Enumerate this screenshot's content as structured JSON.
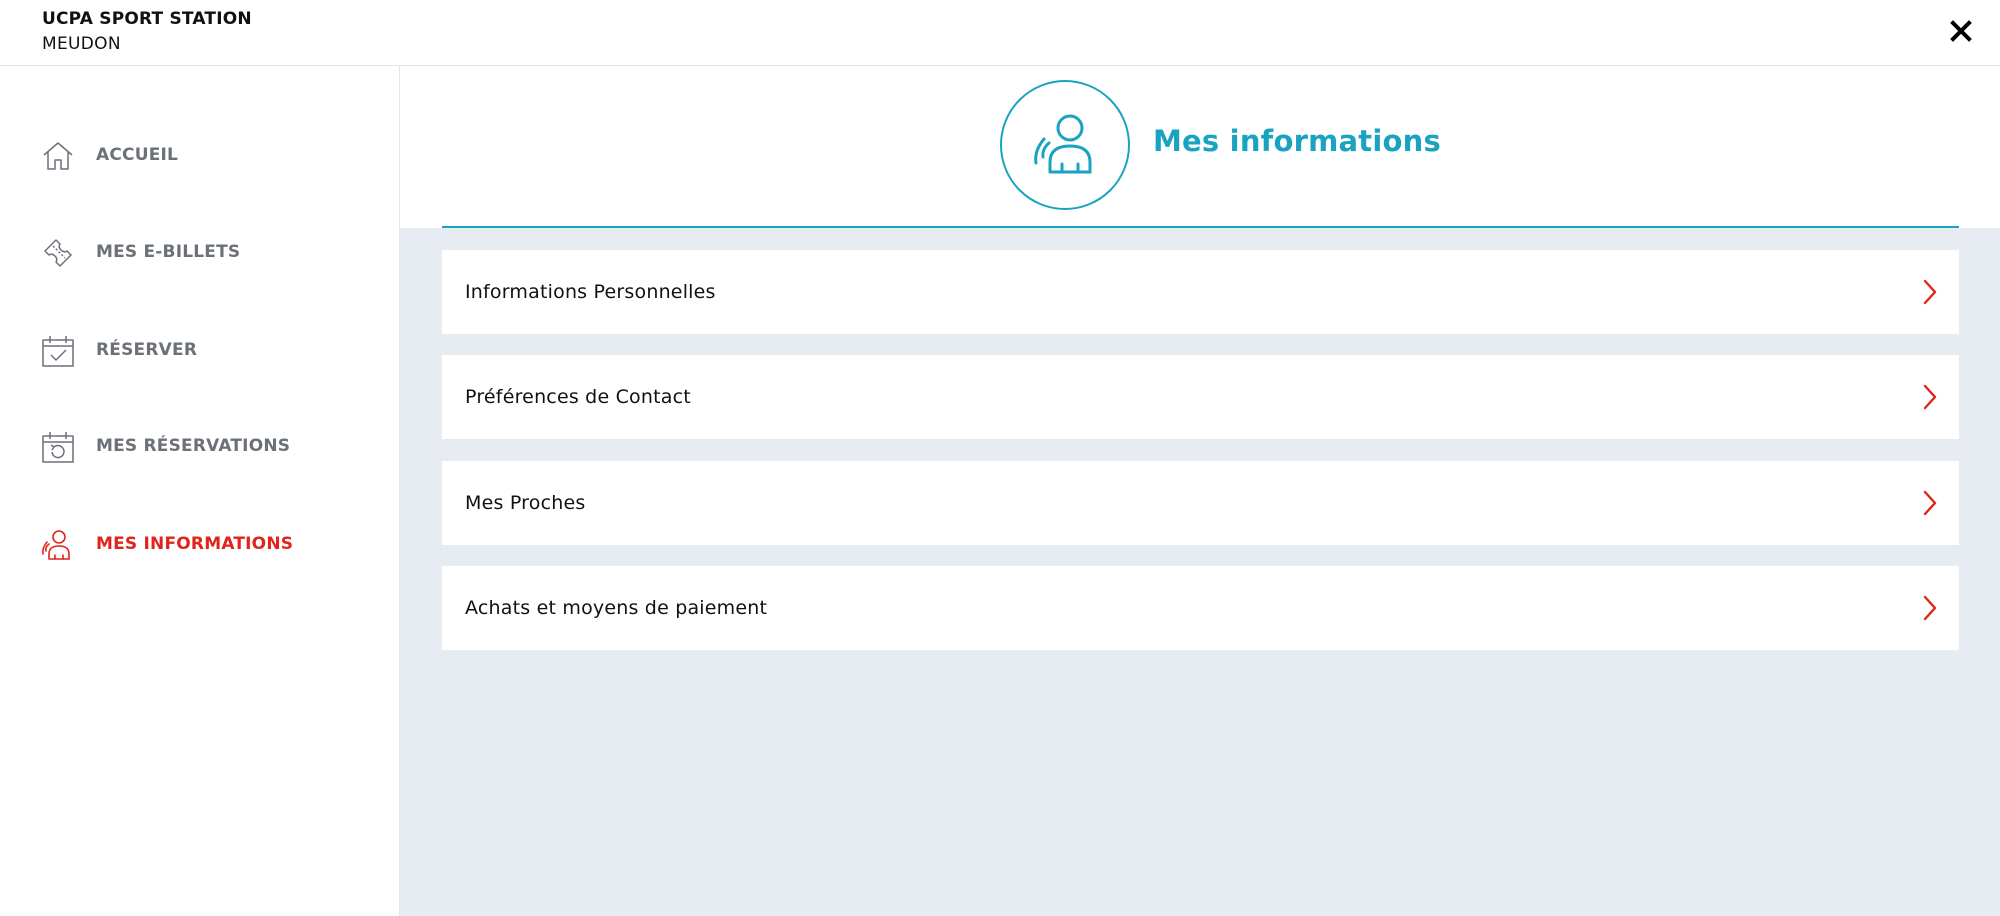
{
  "brand": {
    "name": "UCPA SPORT STATION",
    "location": "MEUDON"
  },
  "colors": {
    "accent": "#1aa3c0",
    "active": "#e0241b",
    "muted": "#6c7178",
    "panel": "#e7ebf2"
  },
  "sidebar": {
    "items": [
      {
        "label": "ACCUEIL",
        "icon": "home-icon"
      },
      {
        "label": "MES E-BILLETS",
        "icon": "ticket-icon"
      },
      {
        "label": "RÉSERVER",
        "icon": "calendar-check-icon"
      },
      {
        "label": "MES RÉSERVATIONS",
        "icon": "calendar-history-icon"
      },
      {
        "label": "MES INFORMATIONS",
        "icon": "user-icon",
        "active": true
      }
    ]
  },
  "main": {
    "title": "Mes informations",
    "header_icon": "user-icon",
    "sections": [
      {
        "label": "Informations Personnelles"
      },
      {
        "label": "Préférences de Contact"
      },
      {
        "label": "Mes Proches"
      },
      {
        "label": "Achats et moyens de paiement"
      }
    ]
  },
  "icons": {
    "close": "close-icon",
    "chevron": "chevron-right-icon"
  }
}
